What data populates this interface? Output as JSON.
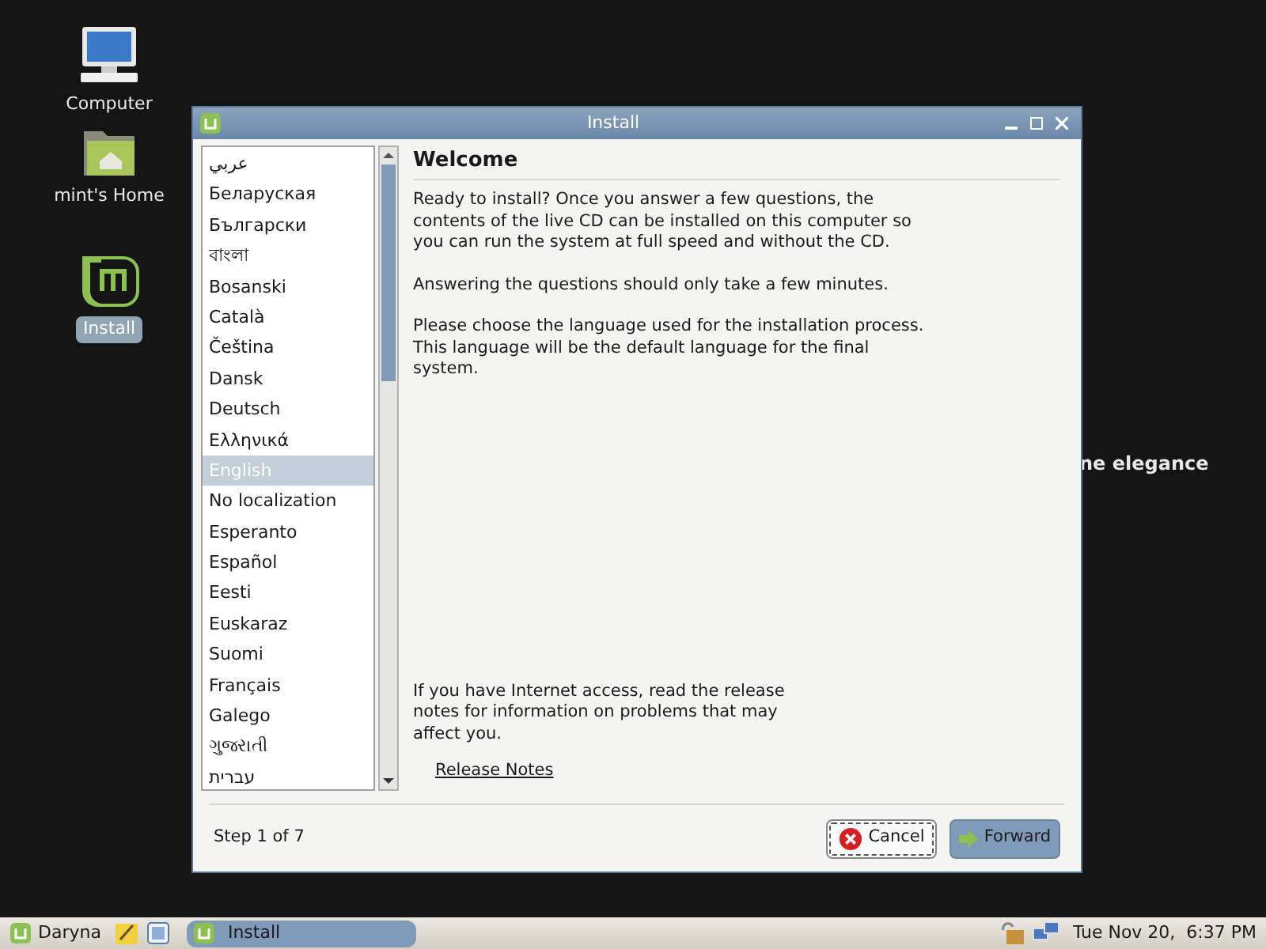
{
  "desktop": {
    "icons": [
      {
        "kind": "computer",
        "label": "Computer",
        "selected": false
      },
      {
        "kind": "home",
        "label": "mint's Home",
        "selected": false
      },
      {
        "kind": "mint",
        "label": "Install",
        "selected": true
      }
    ],
    "wallpaper_text": "ne elegance"
  },
  "window": {
    "title": "Install",
    "languages": [
      {
        "label": "عربي",
        "selected": false
      },
      {
        "label": "Беларуская",
        "selected": false
      },
      {
        "label": "Български",
        "selected": false
      },
      {
        "label": "বাংলা",
        "selected": false
      },
      {
        "label": "Bosanski",
        "selected": false
      },
      {
        "label": "Català",
        "selected": false
      },
      {
        "label": "Čeština",
        "selected": false
      },
      {
        "label": "Dansk",
        "selected": false
      },
      {
        "label": "Deutsch",
        "selected": false
      },
      {
        "label": "Ελληνικά",
        "selected": false
      },
      {
        "label": "English",
        "selected": true
      },
      {
        "label": "No localization",
        "selected": false
      },
      {
        "label": "Esperanto",
        "selected": false
      },
      {
        "label": "Español",
        "selected": false
      },
      {
        "label": "Eesti",
        "selected": false
      },
      {
        "label": "Euskaraz",
        "selected": false
      },
      {
        "label": "Suomi",
        "selected": false
      },
      {
        "label": "Français",
        "selected": false
      },
      {
        "label": "Galego",
        "selected": false
      },
      {
        "label": "ગુજરાતી",
        "selected": false
      },
      {
        "label": "עברית",
        "selected": false
      }
    ],
    "heading": "Welcome",
    "paragraphs": [
      "Ready to install? Once you answer a few questions, the contents of the live CD can be installed on this computer so you can run the system at full speed and without the CD.",
      "Answering the questions should only take a few minutes.",
      "Please choose the language used for the installation process. This language will be the default language for the final system."
    ],
    "release_text": "If you have Internet access, read the release notes for information on problems that may affect you.",
    "release_link": "Release Notes",
    "step": "Step 1 of 7",
    "buttons": [
      {
        "kind": "cancel",
        "label": "Cancel"
      },
      {
        "kind": "forward",
        "label": "Forward"
      }
    ]
  },
  "taskbar": {
    "menu": "Daryna",
    "tasks": [
      "Install"
    ],
    "clock": "Tue Nov 20,  6:37 PM"
  }
}
